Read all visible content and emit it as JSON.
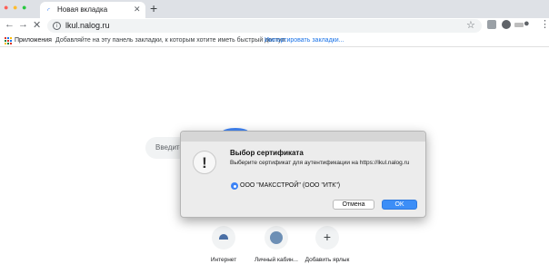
{
  "tab": {
    "title": "Новая вкладка"
  },
  "address": {
    "url": "lkul.nalog.ru"
  },
  "bookmarks": {
    "apps_label": "Приложения",
    "hint": "Добавляйте на эту панель закладки, к которым хотите иметь быстрый доступ.",
    "import_link": "Импортировать закладки..."
  },
  "ntp": {
    "search_placeholder": "Введите",
    "tiles": [
      {
        "label": "Интернет"
      },
      {
        "label": "Личный кабин..."
      },
      {
        "label": "Добавить ярлык"
      }
    ]
  },
  "dialog": {
    "title": "Выбор сертификата",
    "message": "Выберите сертификат для аутентификации на https://lkul.nalog.ru",
    "certificate": "ООО \"МАКССТРОЙ\" (ООО \"ИТК\")",
    "cancel_label": "Отмена",
    "ok_label": "OK"
  },
  "colors": {
    "accent": "#3c8ef7",
    "link": "#1a73e8"
  }
}
